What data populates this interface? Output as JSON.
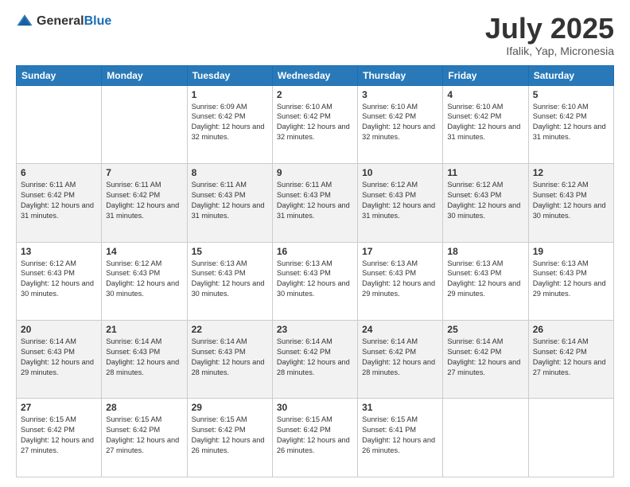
{
  "logo": {
    "general": "General",
    "blue": "Blue"
  },
  "header": {
    "title": "July 2025",
    "subtitle": "Ifalik, Yap, Micronesia"
  },
  "days_of_week": [
    "Sunday",
    "Monday",
    "Tuesday",
    "Wednesday",
    "Thursday",
    "Friday",
    "Saturday"
  ],
  "weeks": [
    [
      {
        "day": "",
        "info": ""
      },
      {
        "day": "",
        "info": ""
      },
      {
        "day": "1",
        "info": "Sunrise: 6:09 AM\nSunset: 6:42 PM\nDaylight: 12 hours and 32 minutes."
      },
      {
        "day": "2",
        "info": "Sunrise: 6:10 AM\nSunset: 6:42 PM\nDaylight: 12 hours and 32 minutes."
      },
      {
        "day": "3",
        "info": "Sunrise: 6:10 AM\nSunset: 6:42 PM\nDaylight: 12 hours and 32 minutes."
      },
      {
        "day": "4",
        "info": "Sunrise: 6:10 AM\nSunset: 6:42 PM\nDaylight: 12 hours and 31 minutes."
      },
      {
        "day": "5",
        "info": "Sunrise: 6:10 AM\nSunset: 6:42 PM\nDaylight: 12 hours and 31 minutes."
      }
    ],
    [
      {
        "day": "6",
        "info": "Sunrise: 6:11 AM\nSunset: 6:42 PM\nDaylight: 12 hours and 31 minutes."
      },
      {
        "day": "7",
        "info": "Sunrise: 6:11 AM\nSunset: 6:42 PM\nDaylight: 12 hours and 31 minutes."
      },
      {
        "day": "8",
        "info": "Sunrise: 6:11 AM\nSunset: 6:43 PM\nDaylight: 12 hours and 31 minutes."
      },
      {
        "day": "9",
        "info": "Sunrise: 6:11 AM\nSunset: 6:43 PM\nDaylight: 12 hours and 31 minutes."
      },
      {
        "day": "10",
        "info": "Sunrise: 6:12 AM\nSunset: 6:43 PM\nDaylight: 12 hours and 31 minutes."
      },
      {
        "day": "11",
        "info": "Sunrise: 6:12 AM\nSunset: 6:43 PM\nDaylight: 12 hours and 30 minutes."
      },
      {
        "day": "12",
        "info": "Sunrise: 6:12 AM\nSunset: 6:43 PM\nDaylight: 12 hours and 30 minutes."
      }
    ],
    [
      {
        "day": "13",
        "info": "Sunrise: 6:12 AM\nSunset: 6:43 PM\nDaylight: 12 hours and 30 minutes."
      },
      {
        "day": "14",
        "info": "Sunrise: 6:12 AM\nSunset: 6:43 PM\nDaylight: 12 hours and 30 minutes."
      },
      {
        "day": "15",
        "info": "Sunrise: 6:13 AM\nSunset: 6:43 PM\nDaylight: 12 hours and 30 minutes."
      },
      {
        "day": "16",
        "info": "Sunrise: 6:13 AM\nSunset: 6:43 PM\nDaylight: 12 hours and 30 minutes."
      },
      {
        "day": "17",
        "info": "Sunrise: 6:13 AM\nSunset: 6:43 PM\nDaylight: 12 hours and 29 minutes."
      },
      {
        "day": "18",
        "info": "Sunrise: 6:13 AM\nSunset: 6:43 PM\nDaylight: 12 hours and 29 minutes."
      },
      {
        "day": "19",
        "info": "Sunrise: 6:13 AM\nSunset: 6:43 PM\nDaylight: 12 hours and 29 minutes."
      }
    ],
    [
      {
        "day": "20",
        "info": "Sunrise: 6:14 AM\nSunset: 6:43 PM\nDaylight: 12 hours and 29 minutes."
      },
      {
        "day": "21",
        "info": "Sunrise: 6:14 AM\nSunset: 6:43 PM\nDaylight: 12 hours and 28 minutes."
      },
      {
        "day": "22",
        "info": "Sunrise: 6:14 AM\nSunset: 6:43 PM\nDaylight: 12 hours and 28 minutes."
      },
      {
        "day": "23",
        "info": "Sunrise: 6:14 AM\nSunset: 6:42 PM\nDaylight: 12 hours and 28 minutes."
      },
      {
        "day": "24",
        "info": "Sunrise: 6:14 AM\nSunset: 6:42 PM\nDaylight: 12 hours and 28 minutes."
      },
      {
        "day": "25",
        "info": "Sunrise: 6:14 AM\nSunset: 6:42 PM\nDaylight: 12 hours and 27 minutes."
      },
      {
        "day": "26",
        "info": "Sunrise: 6:14 AM\nSunset: 6:42 PM\nDaylight: 12 hours and 27 minutes."
      }
    ],
    [
      {
        "day": "27",
        "info": "Sunrise: 6:15 AM\nSunset: 6:42 PM\nDaylight: 12 hours and 27 minutes."
      },
      {
        "day": "28",
        "info": "Sunrise: 6:15 AM\nSunset: 6:42 PM\nDaylight: 12 hours and 27 minutes."
      },
      {
        "day": "29",
        "info": "Sunrise: 6:15 AM\nSunset: 6:42 PM\nDaylight: 12 hours and 26 minutes."
      },
      {
        "day": "30",
        "info": "Sunrise: 6:15 AM\nSunset: 6:42 PM\nDaylight: 12 hours and 26 minutes."
      },
      {
        "day": "31",
        "info": "Sunrise: 6:15 AM\nSunset: 6:41 PM\nDaylight: 12 hours and 26 minutes."
      },
      {
        "day": "",
        "info": ""
      },
      {
        "day": "",
        "info": ""
      }
    ]
  ]
}
